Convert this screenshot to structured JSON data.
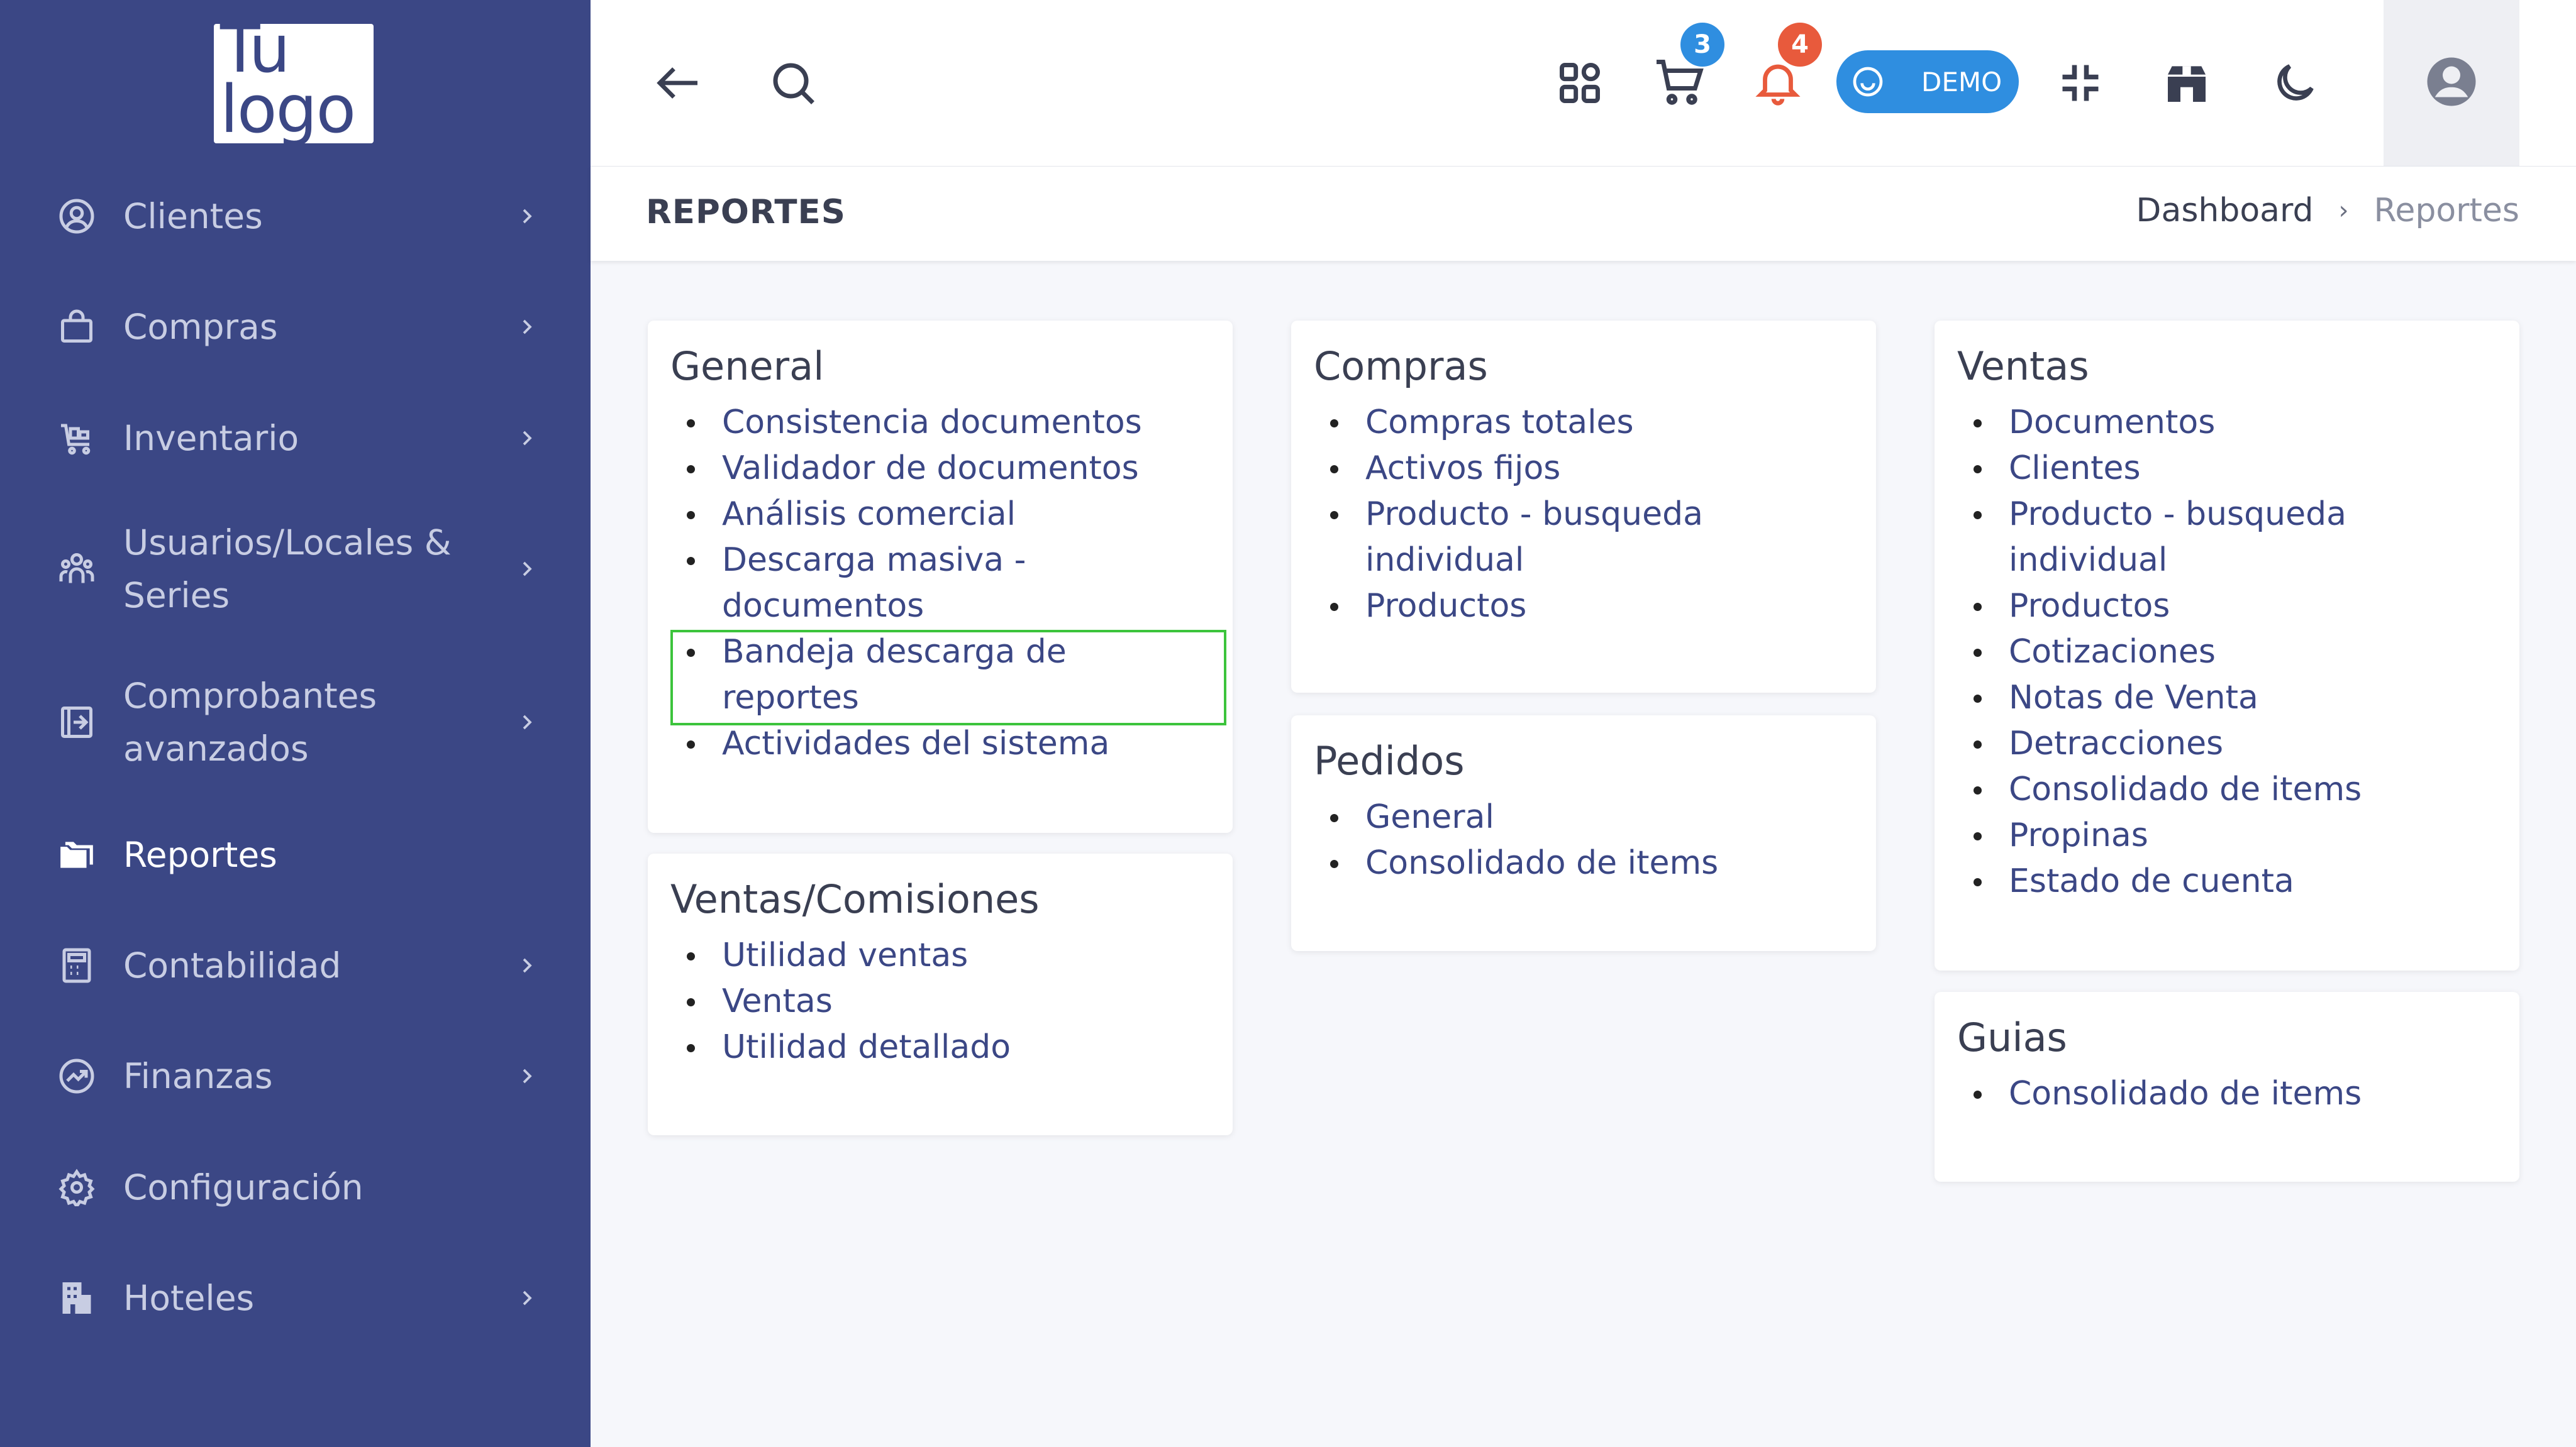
{
  "logo": {
    "text": "Tu\nlogo"
  },
  "sidebar": {
    "items": [
      {
        "label": "Clientes",
        "icon": "user-circle-icon",
        "has_children": true
      },
      {
        "label": "Compras",
        "icon": "shopping-bag-icon",
        "has_children": true
      },
      {
        "label": "Inventario",
        "icon": "inventory-cart-icon",
        "has_children": true
      },
      {
        "label": "Usuarios/Locales &\nSeries",
        "icon": "users-icon",
        "has_children": true
      },
      {
        "label": "Comprobantes\navanzados",
        "icon": "receipt-icon",
        "has_children": true
      },
      {
        "label": "Reportes",
        "icon": "folders-icon",
        "has_children": false,
        "active": true
      },
      {
        "label": "Contabilidad",
        "icon": "calculator-icon",
        "has_children": true
      },
      {
        "label": "Finanzas",
        "icon": "trending-circle-icon",
        "has_children": true
      },
      {
        "label": "Configuración",
        "icon": "gear-icon",
        "has_children": false
      },
      {
        "label": "Hoteles",
        "icon": "building-icon",
        "has_children": true
      }
    ]
  },
  "topbar": {
    "cart_badge": "3",
    "notifications_badge": "4",
    "demo_label": "DEMO",
    "icons": [
      "back-arrow-icon",
      "search-icon",
      "apps-grid-icon",
      "cart-icon",
      "bell-icon",
      "compress-icon",
      "store-icon",
      "moon-icon",
      "user-avatar-icon"
    ],
    "colors": {
      "cart_badge": "#2f8ee0",
      "notifications_badge": "#e85a3c",
      "demo_pill": "#2f8ee0"
    }
  },
  "page_header": {
    "title": "REPORTES",
    "breadcrumb": [
      "Dashboard",
      "Reportes"
    ]
  },
  "cards": {
    "general": {
      "title": "General",
      "items": [
        "Consistencia documentos",
        "Validador de documentos",
        "Análisis comercial",
        "Descarga masiva -\ndocumentos",
        "Bandeja descarga de\nreportes",
        "Actividades del sistema"
      ]
    },
    "ventas_comisiones": {
      "title": "Ventas/Comisiones",
      "items": [
        "Utilidad ventas",
        "Ventas",
        "Utilidad detallado"
      ]
    },
    "compras": {
      "title": "Compras",
      "items": [
        "Compras totales",
        "Activos fijos",
        "Producto - busqueda\nindividual",
        "Productos"
      ]
    },
    "pedidos": {
      "title": "Pedidos",
      "items": [
        "General",
        "Consolidado de items"
      ]
    },
    "ventas": {
      "title": "Ventas",
      "items": [
        "Documentos",
        "Clientes",
        "Producto - busqueda\nindividual",
        "Productos",
        "Cotizaciones",
        "Notas de Venta",
        "Detracciones",
        "Consolidado de items",
        "Propinas",
        "Estado de cuenta"
      ]
    },
    "guias": {
      "title": "Guias",
      "items": [
        "Consolidado de items"
      ]
    }
  },
  "colors": {
    "sidebar_bg": "#3b4785",
    "link": "#3b4785",
    "highlight_box": "#3cc43c"
  }
}
